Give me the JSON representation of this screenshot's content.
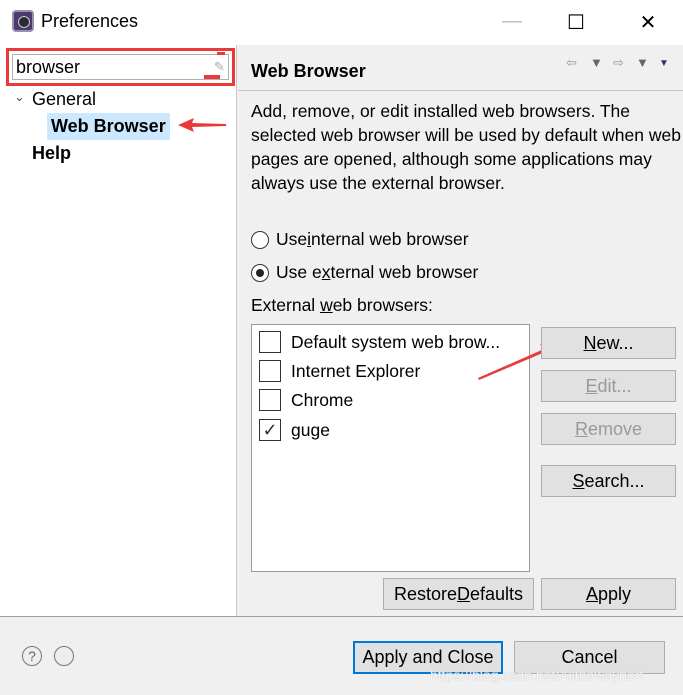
{
  "window": {
    "title": "Preferences",
    "minimize": "—",
    "maximize": "☐",
    "close": "✕"
  },
  "sidebar": {
    "search_value": "browser",
    "tree": [
      {
        "label": "General",
        "expanded": true
      },
      {
        "label": "Web Browser",
        "selected": true
      },
      {
        "label": "Help"
      }
    ]
  },
  "page": {
    "title": "Web Browser",
    "description": "Add, remove, or edit installed web browsers. The selected web browser will be used by default when web pages are opened, although some applications may always use the external browser.",
    "radio_internal": {
      "pre": "Use ",
      "key": "i",
      "post": "nternal web browser",
      "checked": false
    },
    "radio_external": {
      "pre": "Use e",
      "key": "x",
      "post": "ternal web browser",
      "checked": true
    },
    "list_label": {
      "pre": "External ",
      "key": "w",
      "post": "eb browsers:"
    },
    "browsers": [
      {
        "label": "Default system web brow...",
        "checked": false
      },
      {
        "label": "Internet Explorer",
        "checked": false
      },
      {
        "label": "Chrome",
        "checked": false
      },
      {
        "label": "guge",
        "checked": true
      }
    ],
    "buttons": {
      "new": {
        "key": "N",
        "rest": "ew..."
      },
      "edit": {
        "key": "E",
        "rest": "dit..."
      },
      "remove": {
        "key": "R",
        "rest": "emove"
      },
      "search": {
        "key": "S",
        "rest": "earch..."
      },
      "restore": {
        "pre": "Restore ",
        "key": "D",
        "rest": "efaults"
      },
      "apply": {
        "key": "A",
        "rest": "pply"
      }
    }
  },
  "footer": {
    "apply_close": "Apply and Close",
    "cancel": "Cancel",
    "help_icon": "?"
  },
  "watermark": "https://blog.csdn.net/Allthewaynort",
  "annotation_color": "#e83a3a"
}
